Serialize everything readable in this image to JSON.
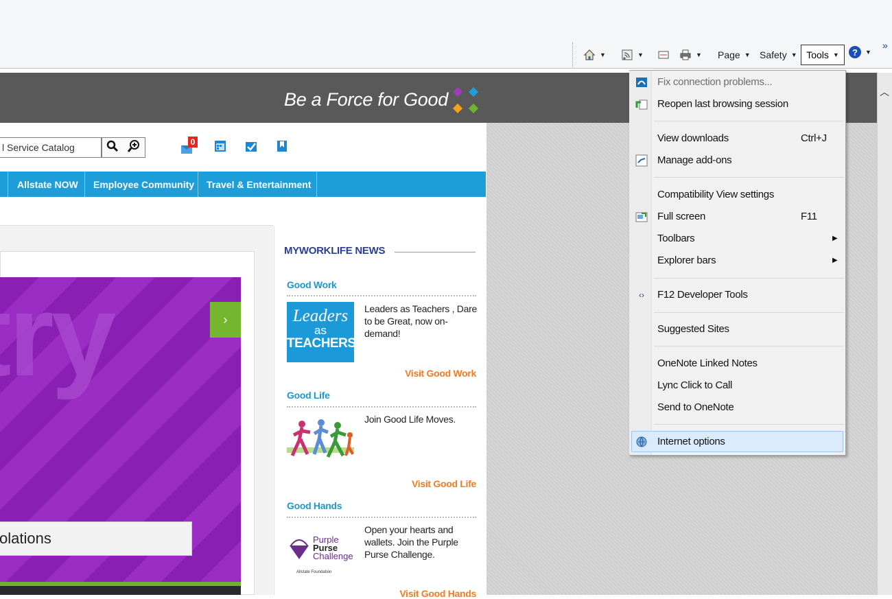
{
  "toolbar": {
    "page_label": "Page",
    "safety_label": "Safety",
    "tools_label": "Tools",
    "more_label": "»"
  },
  "banner": {
    "tagline": "Be a Force for Good"
  },
  "search": {
    "value": "l Service Catalog"
  },
  "badges": {
    "mail_count": "0"
  },
  "nav": {
    "tabs": [
      "Allstate NOW",
      "Employee Community",
      "Travel & Entertainment"
    ]
  },
  "hero": {
    "big_text": "try",
    "caption": "olations",
    "next_label": "›"
  },
  "news": {
    "title": "MYWORKLIFE NEWS",
    "sections": [
      {
        "title": "Good Work",
        "text": "Leaders as Teachers , Dare to be Great, now on-demand!",
        "link": "Visit Good Work",
        "image_text": [
          "Leaders",
          "as",
          "TEACHERS"
        ]
      },
      {
        "title": "Good Life",
        "text": "Join Good Life Moves.",
        "link": "Visit Good Life"
      },
      {
        "title": "Good Hands",
        "text": "Open your hearts and wallets. Join the Purple Purse Challenge.",
        "link": "Visit Good Hands",
        "image_text": [
          "Purple",
          "Purse",
          "Challenge",
          "Allstate Foundation"
        ]
      }
    ]
  },
  "menu": {
    "items": [
      {
        "label": "Fix connection problems...",
        "shortcut": "",
        "disabled": true,
        "icon": "fix-connection-icon"
      },
      {
        "label": "Reopen last browsing session",
        "shortcut": "",
        "icon": "reopen-session-icon"
      },
      {
        "label": "View downloads",
        "shortcut": "Ctrl+J"
      },
      {
        "label": "Manage add-ons",
        "shortcut": "",
        "icon": "manage-addons-icon"
      },
      {
        "label": "Compatibility View settings",
        "shortcut": ""
      },
      {
        "label": "Full screen",
        "shortcut": "F11",
        "icon": "full-screen-icon"
      },
      {
        "label": "Toolbars",
        "submenu": true
      },
      {
        "label": "Explorer bars",
        "submenu": true
      },
      {
        "label": "F12 Developer Tools",
        "shortcut": "",
        "icon": "developer-tools-icon"
      },
      {
        "label": "Suggested Sites",
        "shortcut": ""
      },
      {
        "label": "OneNote Linked Notes",
        "shortcut": ""
      },
      {
        "label": "Lync Click to Call",
        "shortcut": ""
      },
      {
        "label": "Send to OneNote",
        "shortcut": ""
      },
      {
        "label": "Internet options",
        "shortcut": "",
        "icon": "internet-options-icon",
        "highlighted": true
      }
    ]
  },
  "colors": {
    "nav_blue": "#1e9ed8",
    "banner_gray": "#595959",
    "hero_purple": "#8a1fb3",
    "link_orange": "#f47b20",
    "section_blue": "#1e96cf",
    "accent_green": "#74b72e"
  }
}
